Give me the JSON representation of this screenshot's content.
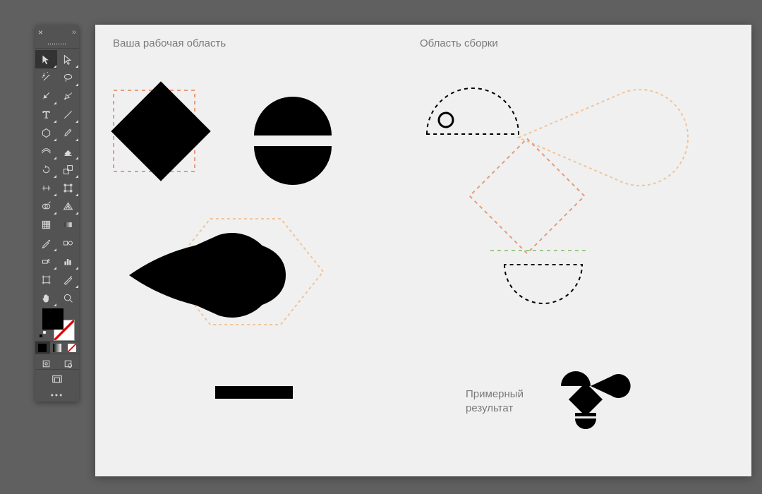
{
  "panel": {
    "close": "×",
    "collapse": "»"
  },
  "canvas": {
    "workspace_label": "Ваша рабочая область",
    "assembly_label": "Область сборки",
    "result_label": "Примерный\nрезультат"
  },
  "bottom_dots": "•••"
}
